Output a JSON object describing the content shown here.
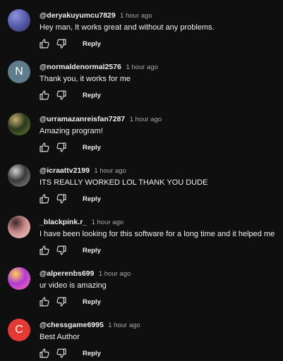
{
  "comments": [
    {
      "author": "@deryakuyumcu7829",
      "time": "1 hour ago",
      "text": "Hey man, It works great and without any problems.",
      "reply_label": "Reply",
      "avatar": {
        "kind": "image",
        "colors": [
          "#5a5fb0",
          "#2b2e5a",
          "#8f94d8"
        ]
      }
    },
    {
      "author": "@normaldenormal2576",
      "time": "1 hour ago",
      "text": "Thank you, it works for me",
      "reply_label": "Reply",
      "avatar": {
        "kind": "letter",
        "letter": "N",
        "color": "#607d8b"
      }
    },
    {
      "author": "@urramazanreisfan7287",
      "time": "1 hour ago",
      "text": "Amazing program!",
      "reply_label": "Reply",
      "avatar": {
        "kind": "image",
        "colors": [
          "#2b3a1c",
          "#6b7a3a",
          "#c8b072"
        ]
      }
    },
    {
      "author": "@icraattv2199",
      "time": "1 hour ago",
      "text": "ITS REALLY WORKED LOL THANK YOU DUDE",
      "reply_label": "Reply",
      "avatar": {
        "kind": "image",
        "colors": [
          "#3a3a3a",
          "#8a8a8a",
          "#d0d0d0"
        ]
      }
    },
    {
      "author": "_blackpink.r_",
      "time": "1 hour ago",
      "text": "I have been looking for this software for a long time and it helped me",
      "reply_label": "Reply",
      "avatar": {
        "kind": "image",
        "colors": [
          "#c98a8a",
          "#f2d0c8",
          "#3a2424"
        ]
      }
    },
    {
      "author": "@alperenbs699",
      "time": "1 hour ago",
      "text": "ur video is amazing",
      "reply_label": "Reply",
      "avatar": {
        "kind": "image",
        "colors": [
          "#b23bd6",
          "#ff6fb0",
          "#ffd24a"
        ]
      }
    },
    {
      "author": "@chessgame6995",
      "time": "1 hour ago",
      "text": "Best Author",
      "reply_label": "Reply",
      "avatar": {
        "kind": "letter",
        "letter": "C",
        "color": "#e53935"
      }
    }
  ],
  "icons": {
    "like": "thumbs-up-icon",
    "dislike": "thumbs-down-icon"
  },
  "colors": {
    "background": "#0f0f0f",
    "text": "#f1f1f1",
    "secondary_text": "#aaaaaa"
  }
}
